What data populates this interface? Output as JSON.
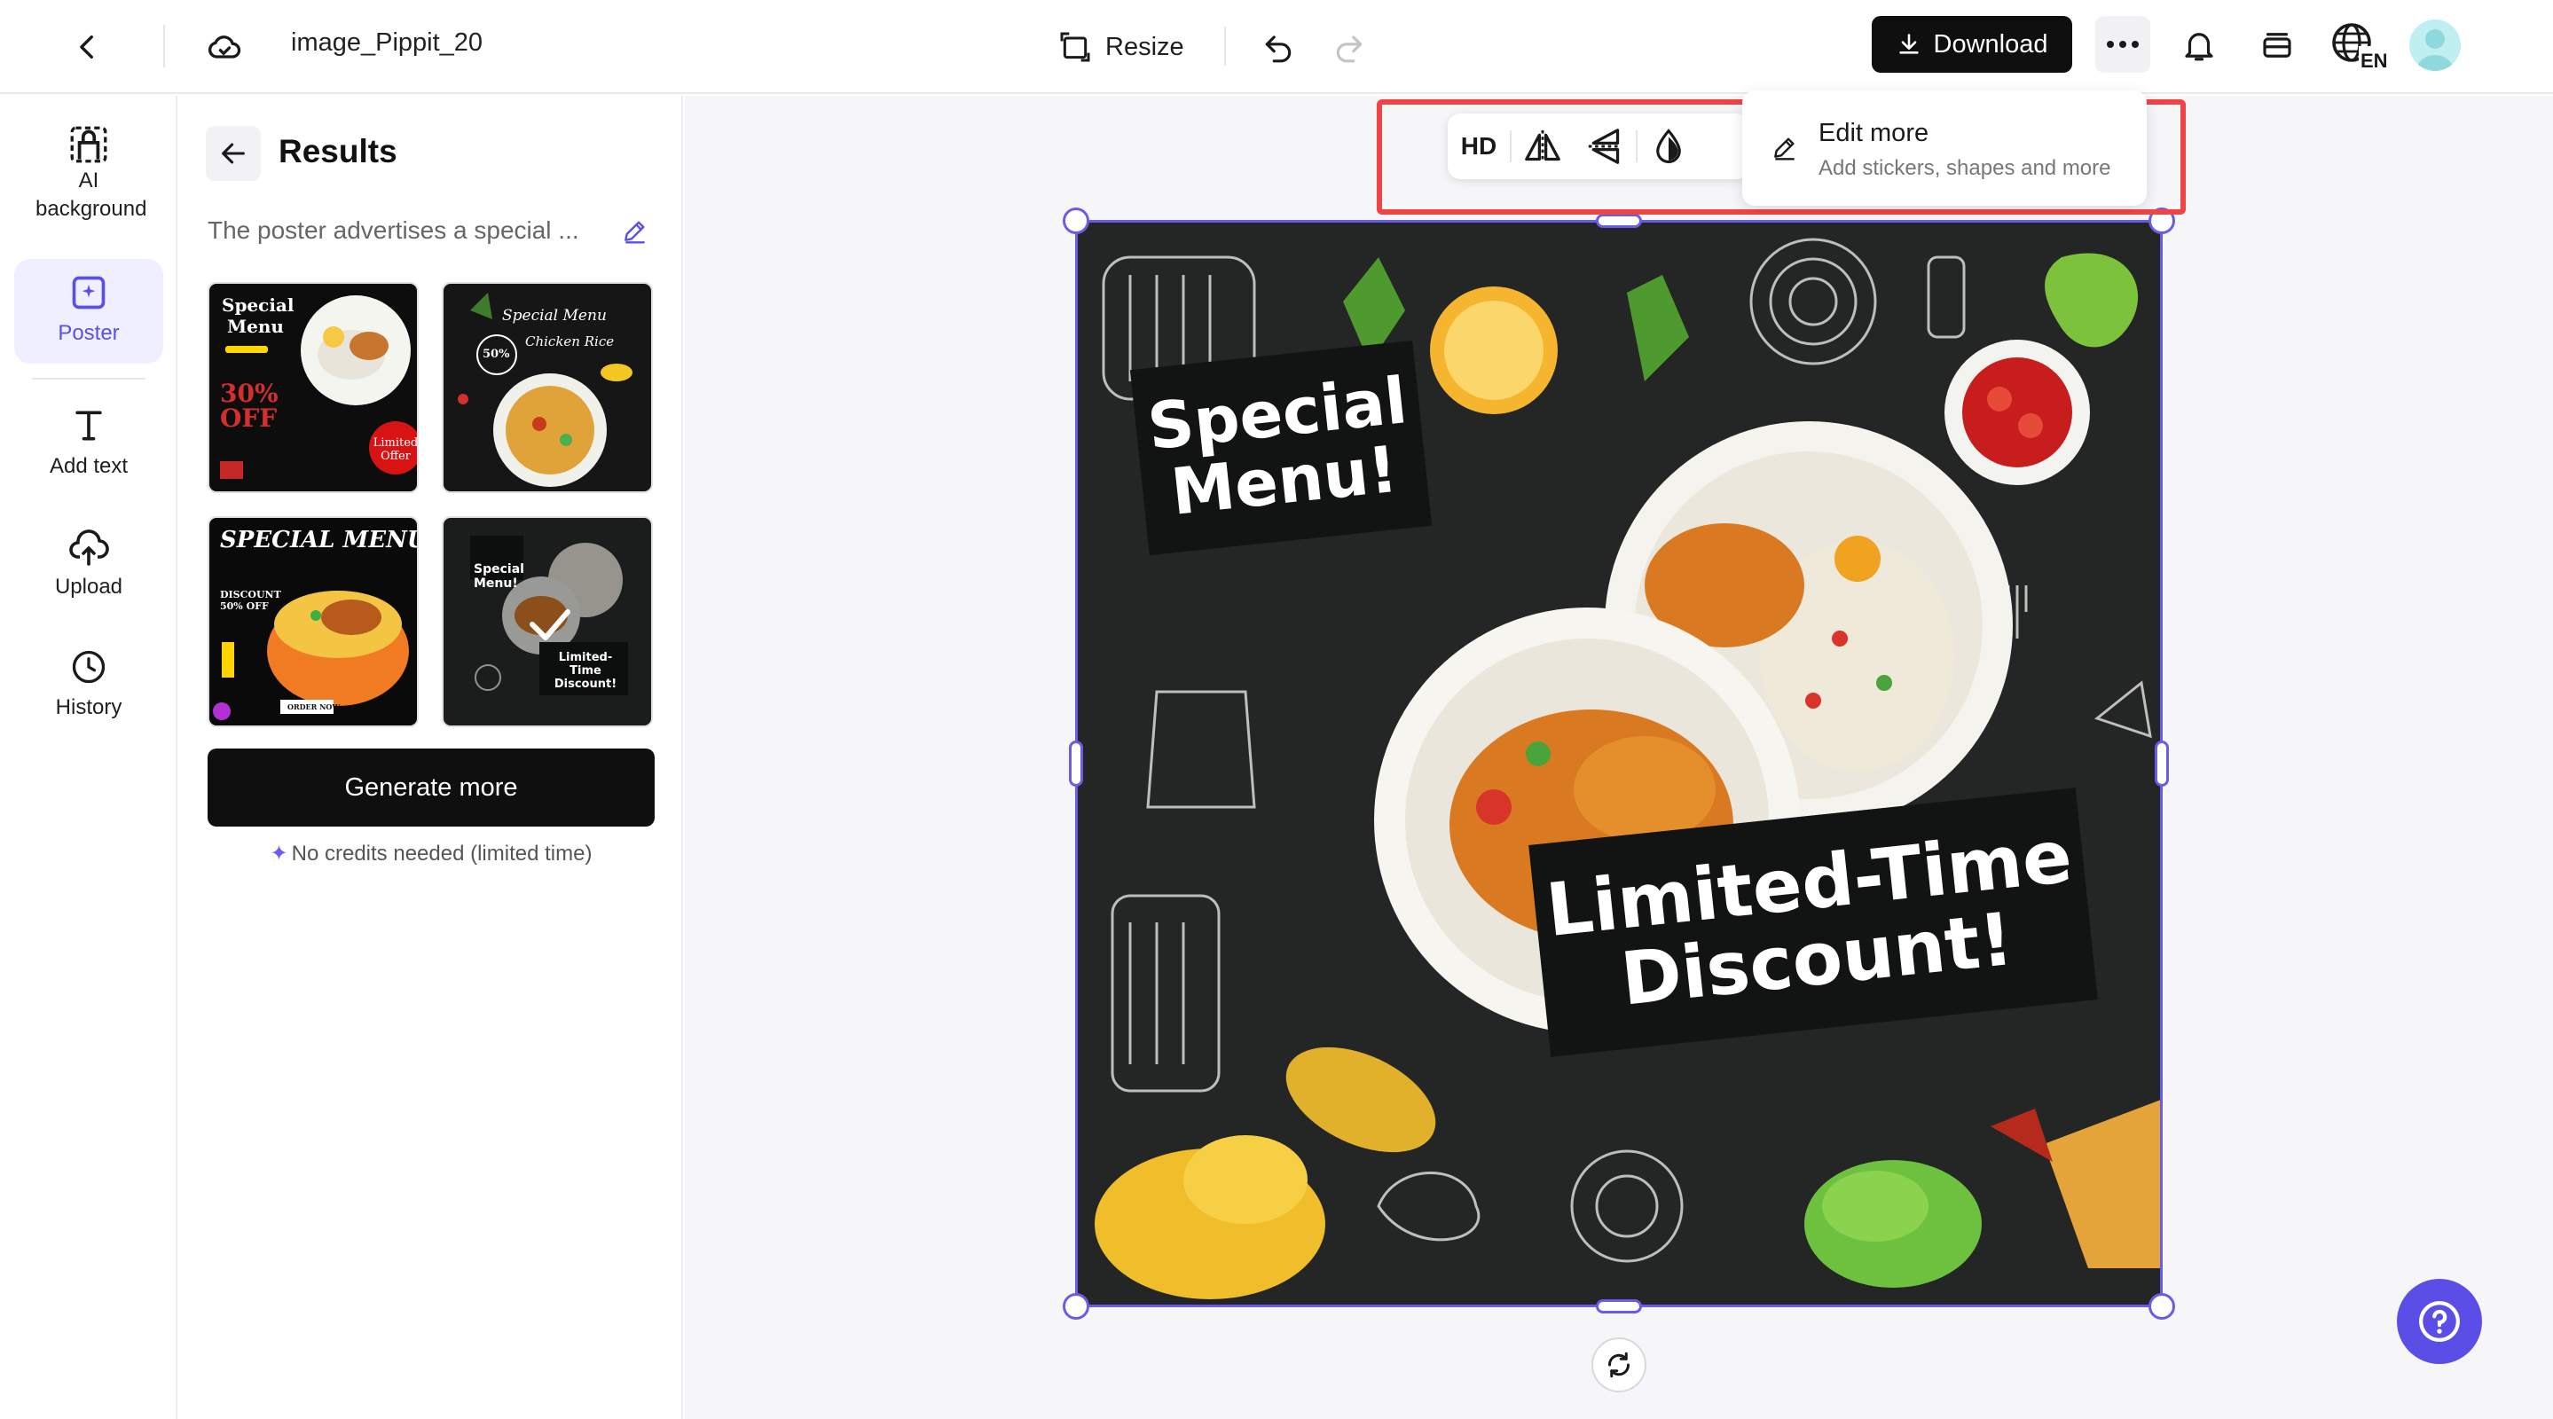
{
  "header": {
    "doc_title": "image_Pippit_20",
    "resize_label": "Resize",
    "download_label": "Download",
    "lang_label": "EN"
  },
  "rail": {
    "items": [
      {
        "label": "AI background",
        "icon": "ai-background-icon"
      },
      {
        "label": "Poster",
        "icon": "poster-icon"
      },
      {
        "label": "Add text",
        "icon": "text-icon"
      },
      {
        "label": "Upload",
        "icon": "upload-icon"
      },
      {
        "label": "History",
        "icon": "history-icon"
      }
    ]
  },
  "results": {
    "title": "Results",
    "prompt": "The poster advertises a special ...",
    "thumbnails": [
      {
        "line1": "Special",
        "line2": "Menu",
        "line3": "30% OFF",
        "badge": "Limited Offer"
      },
      {
        "line1": "Special Menu",
        "line2": "Chicken Rice",
        "badge": "50%"
      },
      {
        "line1": "SPECIAL MENU",
        "line2": "DISCOUNT 50% OFF",
        "badge": "ORDER NOW"
      },
      {
        "line1": "Special Menu!",
        "line2": "Limited-Time Discount!"
      }
    ],
    "generate_label": "Generate more",
    "credits_note": "No credits needed (limited time)"
  },
  "toolbar": {
    "hd_label": "HD"
  },
  "edit_more": {
    "title": "Edit more",
    "subtitle": "Add stickers, shapes and more"
  },
  "poster": {
    "headline": "Special Menu!",
    "headline_line1": "Special",
    "headline_line2": "Menu!",
    "promo_line1": "Limited-Time",
    "promo_line2": "Discount!"
  },
  "colors": {
    "accent": "#5b4ee6",
    "highlight": "#ef4444",
    "download_bg": "#0f0f10"
  }
}
